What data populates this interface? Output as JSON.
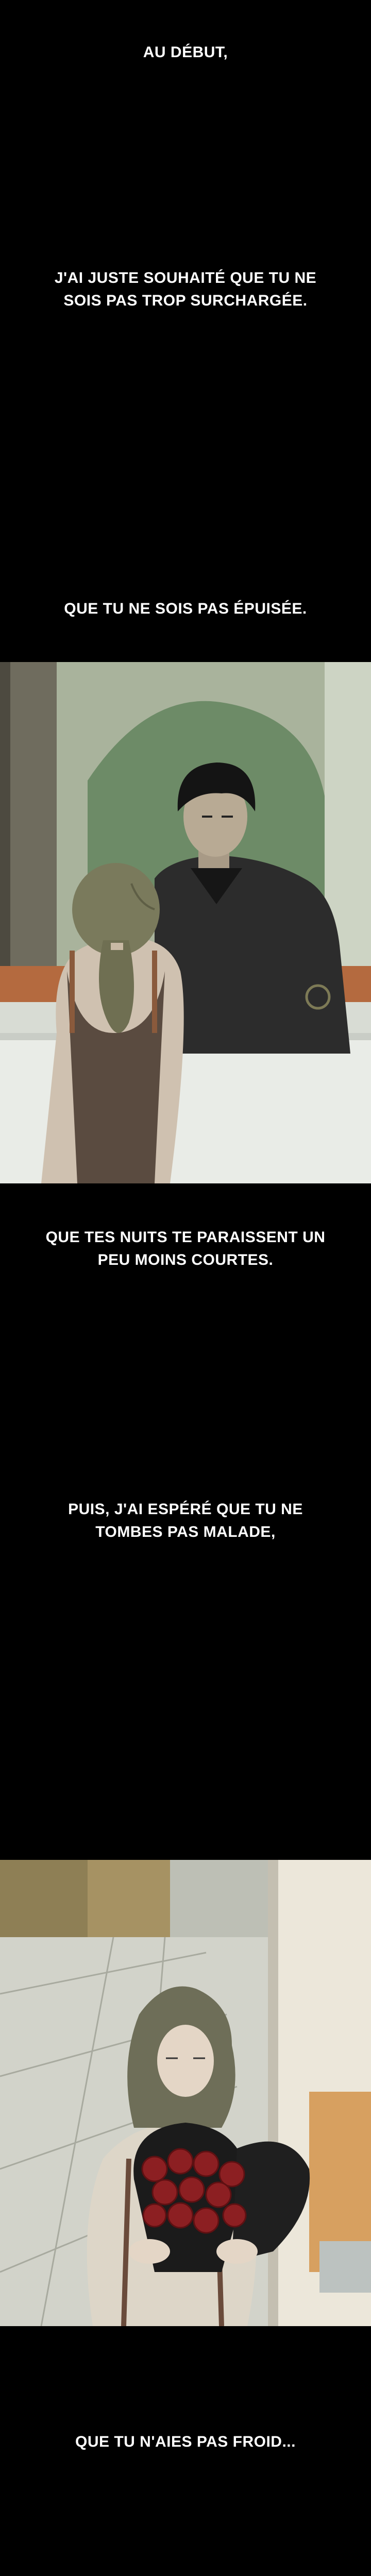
{
  "captions": {
    "c1": "AU DÉBUT,",
    "c2": "J'AI JUSTE SOUHAITÉ QUE TU NE\nSOIS PAS TROP SURCHARGÉE.",
    "c3": "QUE TU NE SOIS PAS ÉPUISÉE.",
    "c4": "QUE TES NUITS TE PARAISSENT UN\nPEU MOINS COURTES.",
    "c5": "PUIS, J'AI ESPÉRÉ QUE TU NE\nTOMBES PAS MALADE,",
    "c6": "QUE TU N'AIES PAS FROID..."
  },
  "colors": {
    "background": "#000000",
    "caption_text": "#ffffff",
    "panel1_wall": "#a9b39c",
    "panel2_wall": "#ece7da",
    "roses": "#8c1f22"
  }
}
